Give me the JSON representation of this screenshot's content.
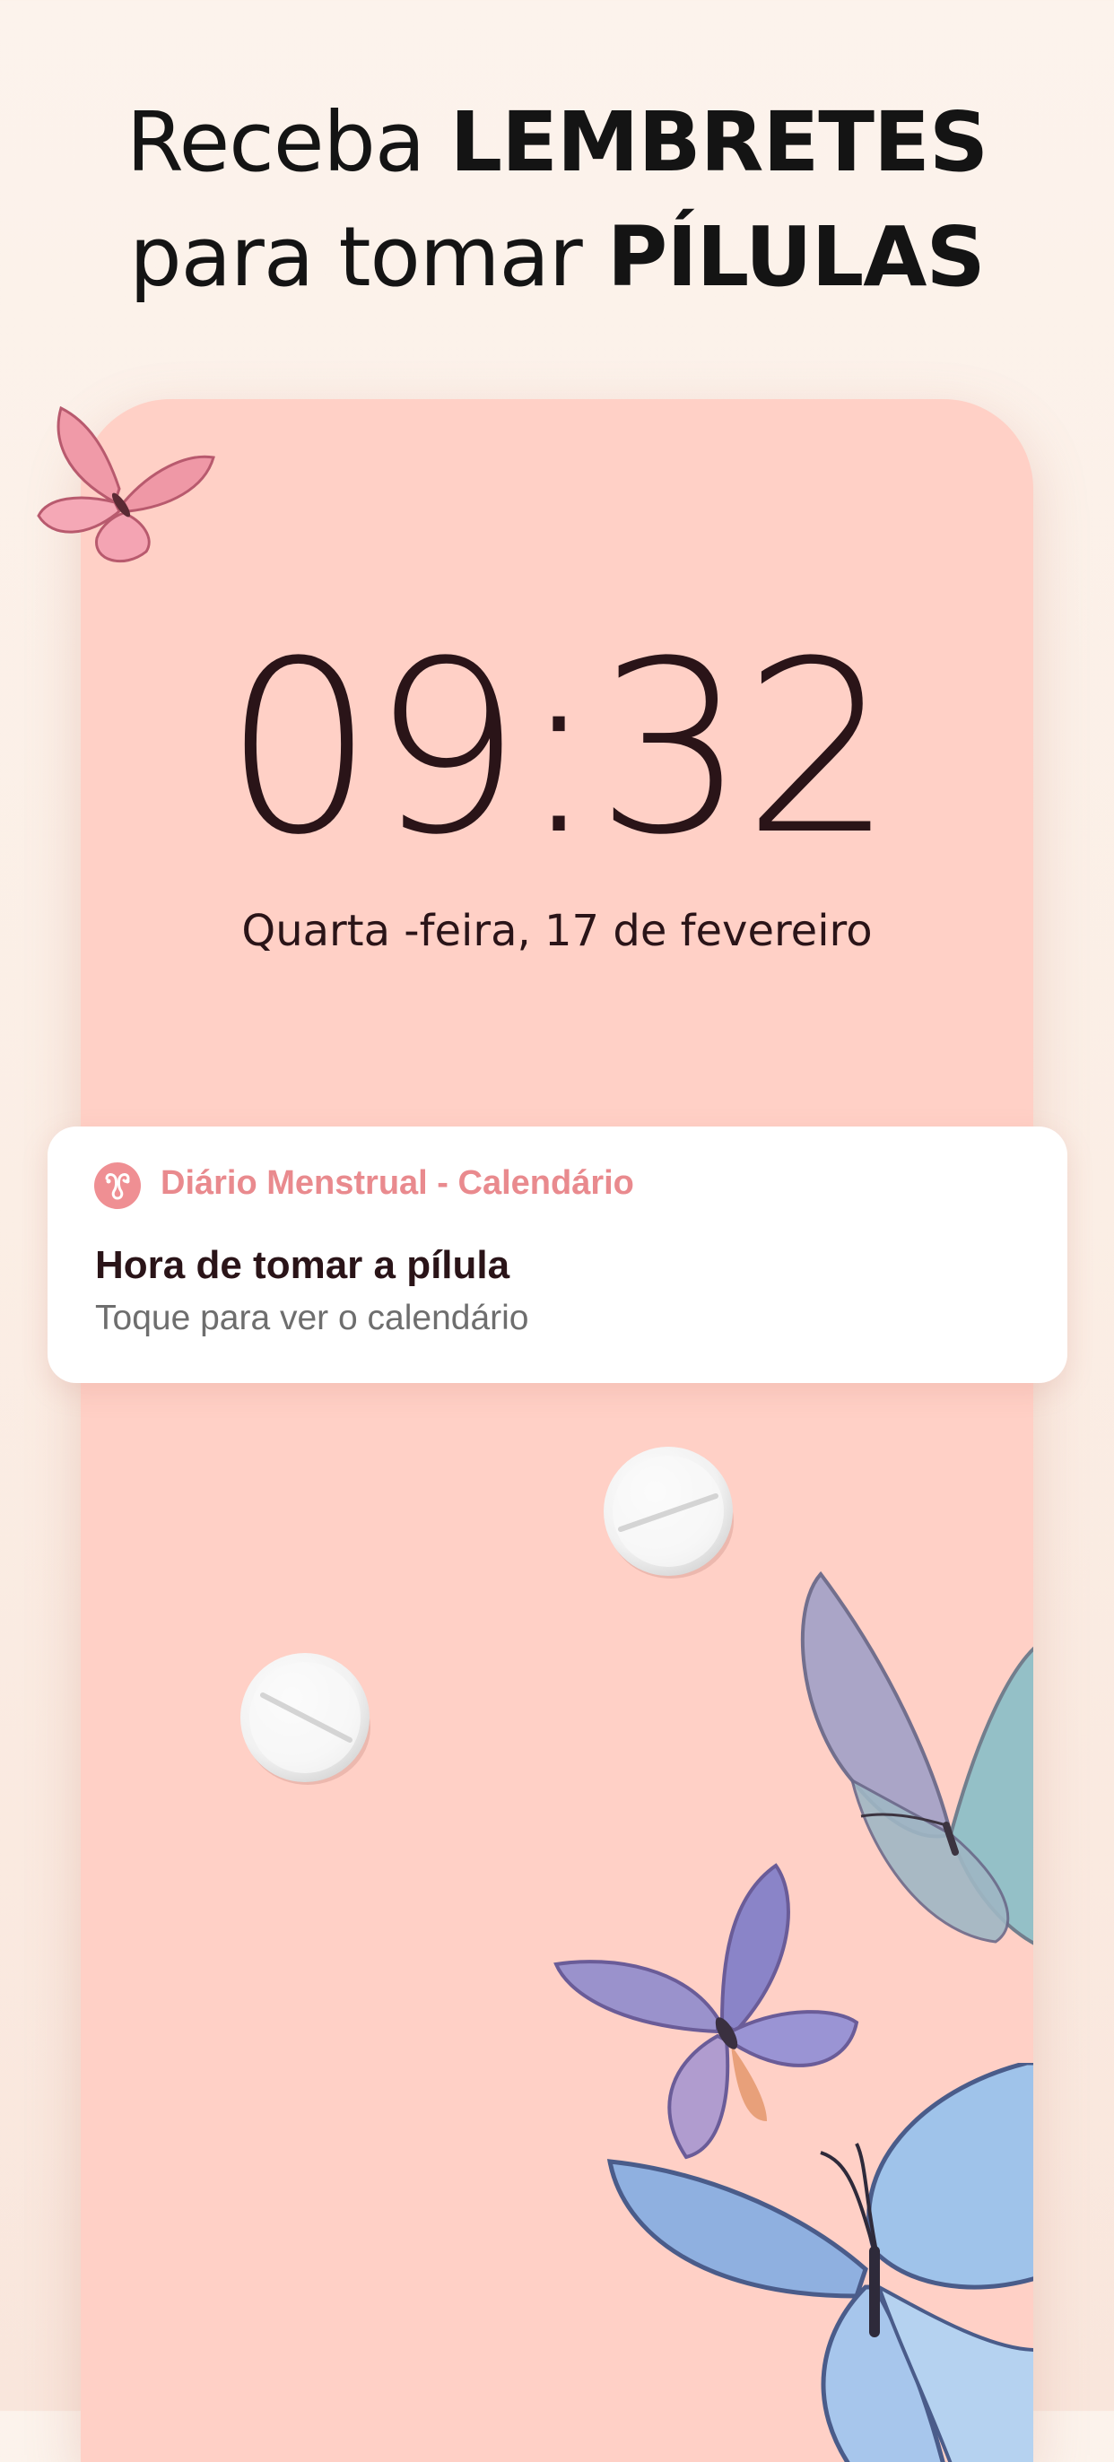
{
  "headline": {
    "line1_regular": "Receba ",
    "line1_bold": "LEMBRETES",
    "line2_regular": "para tomar ",
    "line2_bold": "PÍLULAS"
  },
  "lock_screen": {
    "time": "09:32",
    "date": "Quarta -feira, 17 de fevereiro"
  },
  "notification": {
    "app_icon": "uterus-flower-icon",
    "app_name": "Diário Menstrual - Calendário",
    "title": "Hora de tomar a pílula",
    "body": "Toque para ver o calendário"
  },
  "decorations": {
    "pills": [
      "pill-icon",
      "pill-icon"
    ],
    "butterflies": [
      "pink-butterfly",
      "teal-butterfly",
      "purple-butterfly",
      "blue-butterfly"
    ]
  },
  "colors": {
    "background": "#fcf3ec",
    "phone_screen": "#ffd0c6",
    "app_accent": "#e98a8e",
    "text_dark": "#2a1418"
  }
}
